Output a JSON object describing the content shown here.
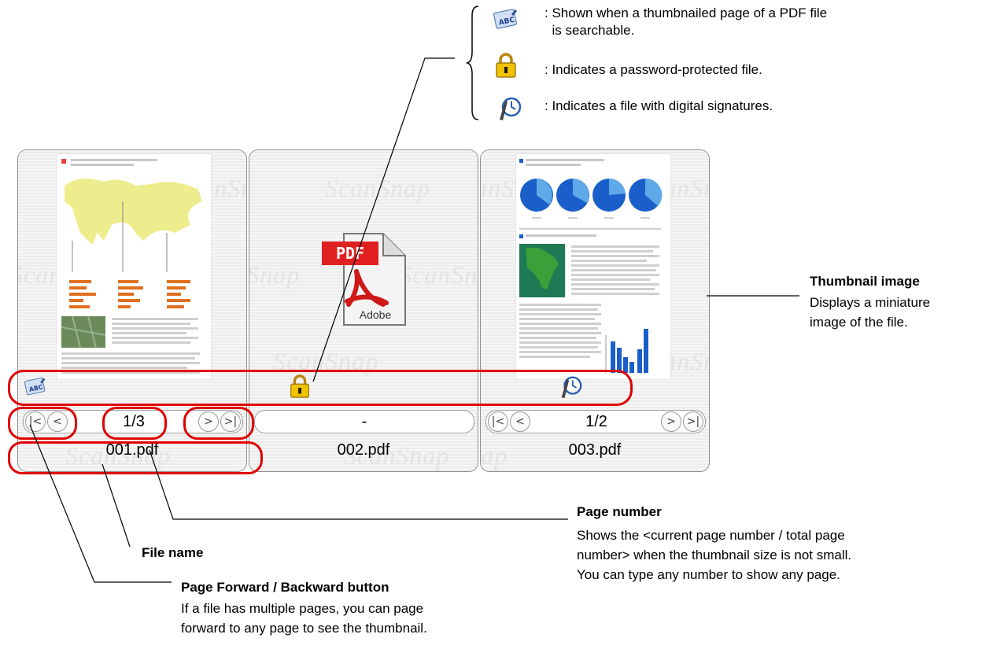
{
  "legend": {
    "items": [
      {
        "icon": "searchable-abc-icon",
        "text": ": Shown when a thumbnailed page of a PDF file\n  is searchable."
      },
      {
        "icon": "lock-icon",
        "text": ": Indicates a password-protected file."
      },
      {
        "icon": "digital-signature-icon",
        "text": ": Indicates a file with digital signatures."
      }
    ]
  },
  "panels": [
    {
      "page_number": "1/3",
      "file_name": "001.pdf",
      "status_icon": "searchable-abc-icon"
    },
    {
      "page_number": "-",
      "file_name": "002.pdf",
      "status_icon": "lock-icon",
      "pdf_label": "PDF",
      "adobe_label": "Adobe"
    },
    {
      "page_number": "1/2",
      "file_name": "003.pdf",
      "status_icon": "digital-signature-icon"
    }
  ],
  "watermark": "ScanSnap",
  "annotations": {
    "thumbnail": {
      "title": "Thumbnail image",
      "text": "Displays a miniature\nimage of the file."
    },
    "page_number": {
      "title": "Page number",
      "text": "Shows the <current page number / total page\nnumber> when the thumbnail size is not small.\nYou can type any number to show any page."
    },
    "file_name": {
      "title": "File name"
    },
    "page_nav": {
      "title": "Page Forward / Backward button",
      "text": "If a file has multiple pages, you can page\nforward to any page to see the thumbnail."
    }
  },
  "colors": {
    "callout": "#e00000",
    "pie_dark": "#1a5fc9",
    "pie_light": "#5ea9e8",
    "map_yellow": "#ecec8a",
    "map_green": "#2e8b3e"
  }
}
